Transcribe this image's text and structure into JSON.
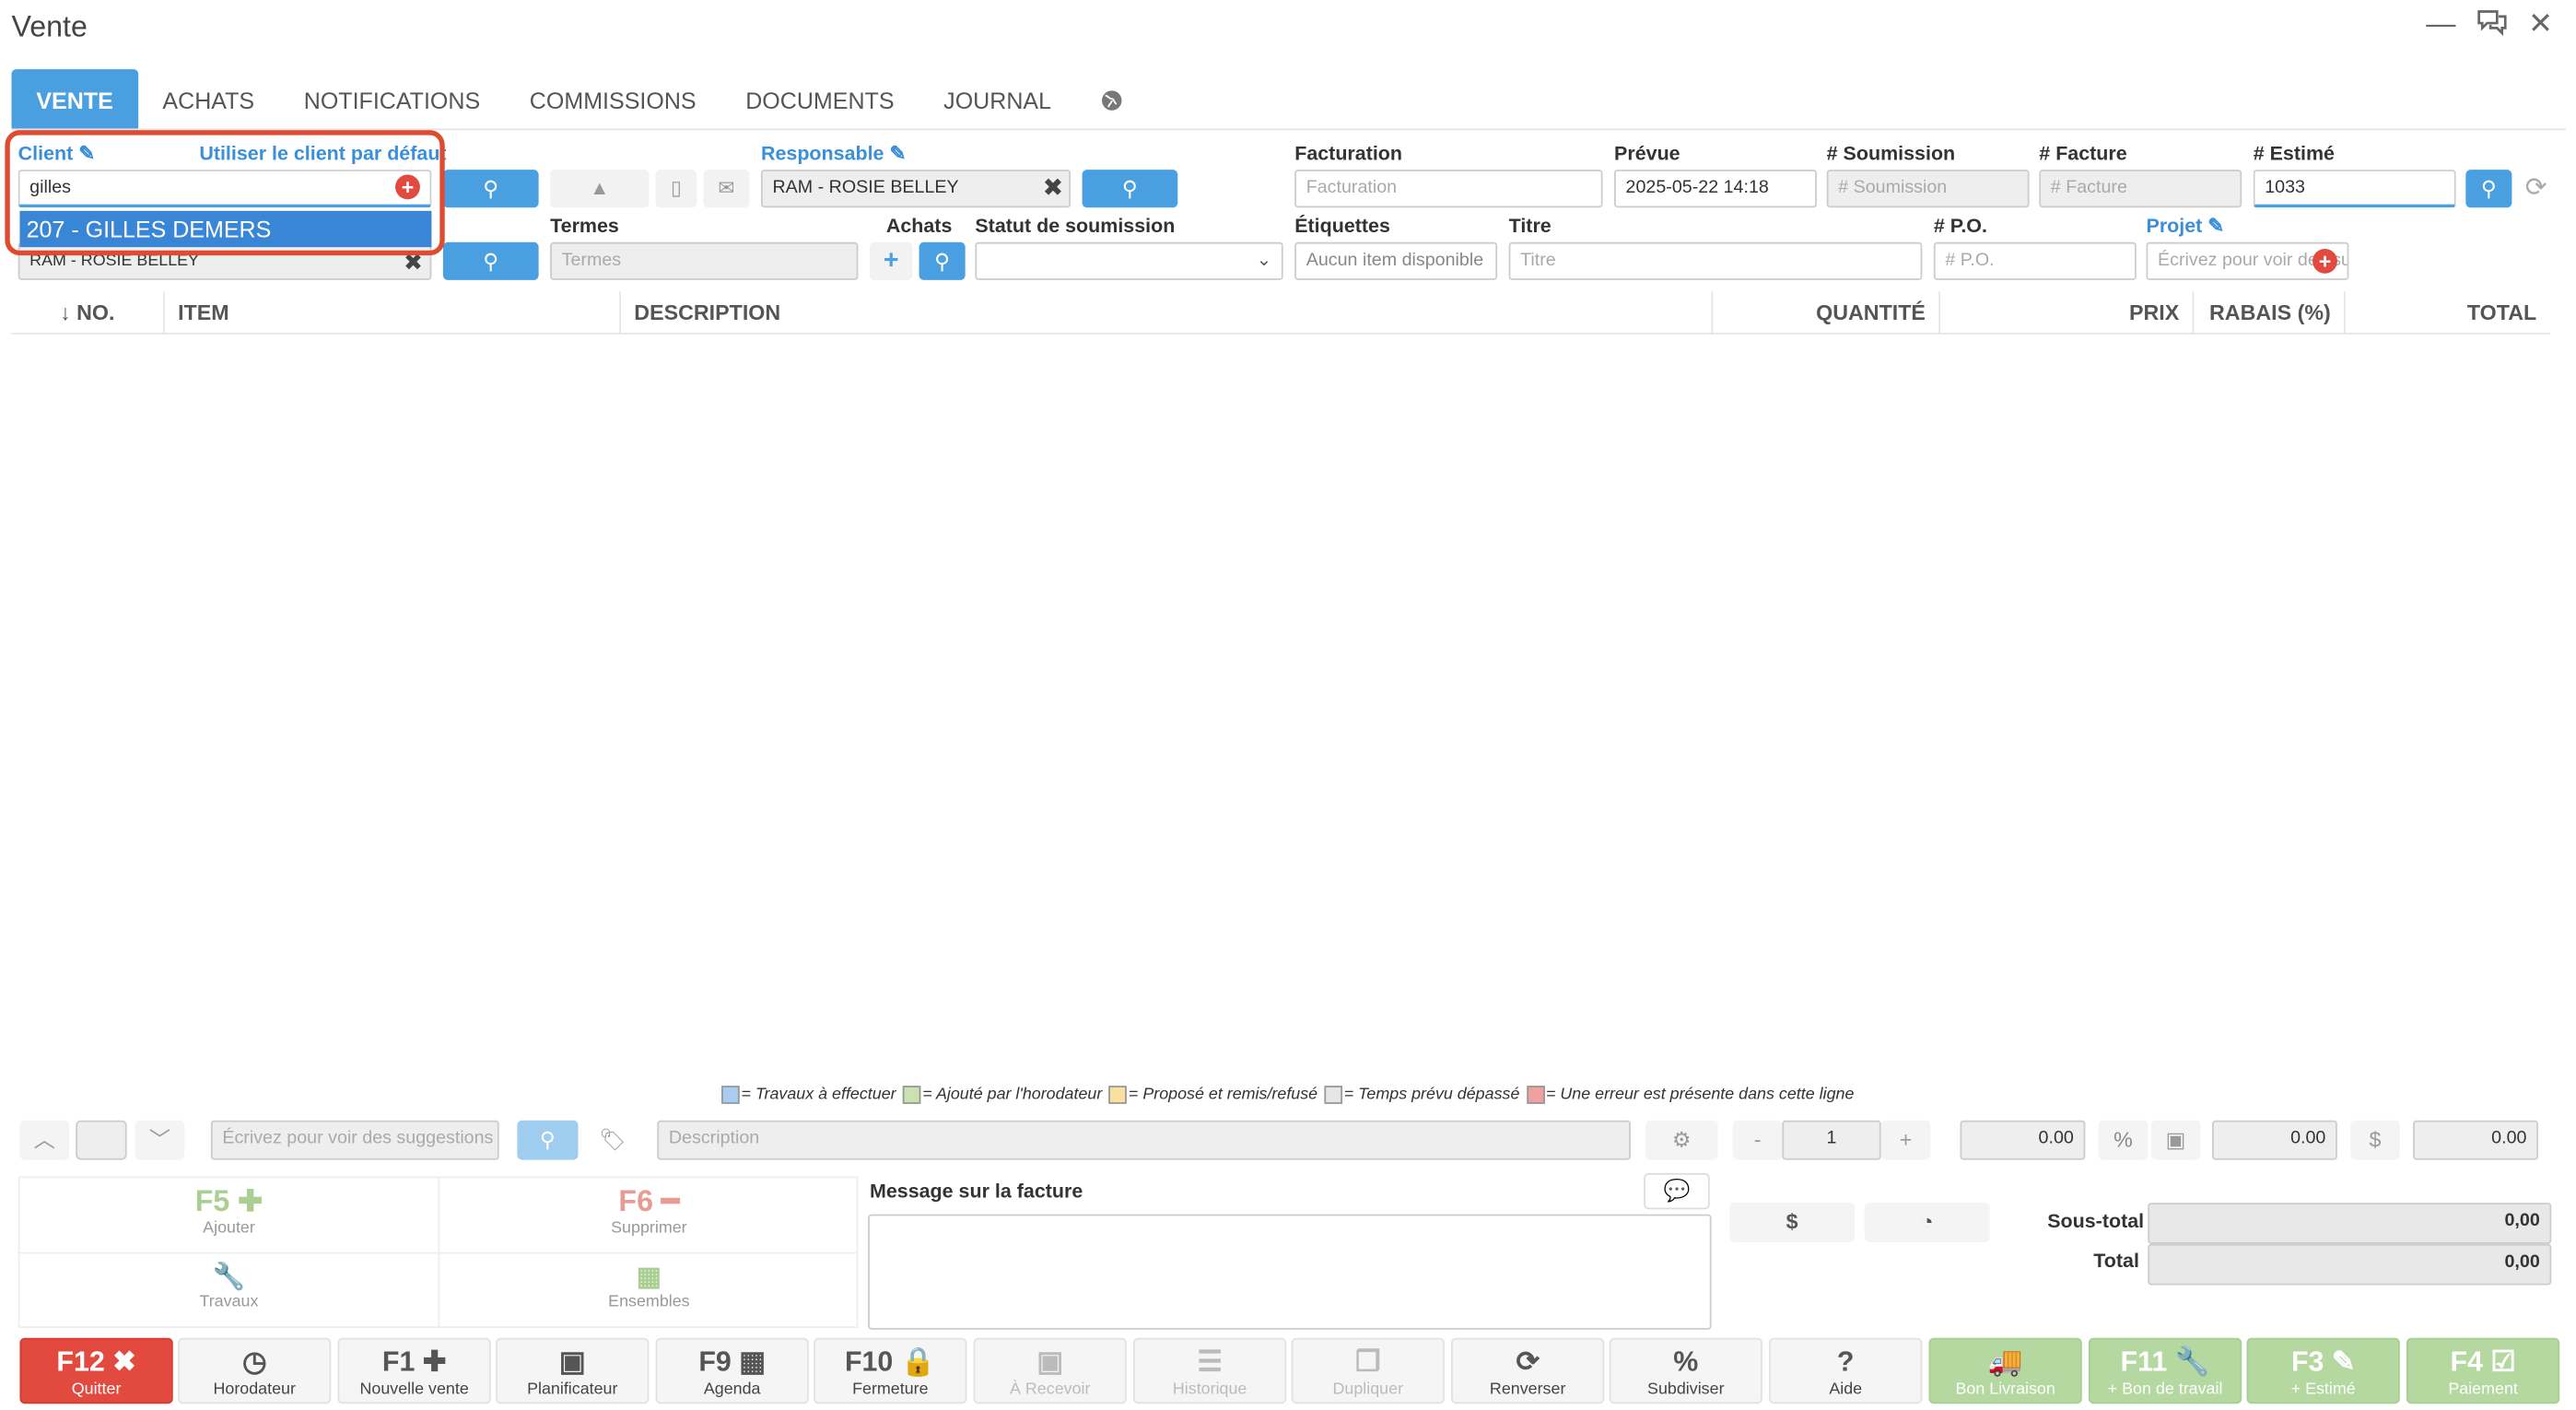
{
  "window": {
    "title": "Vente"
  },
  "tabs": [
    "VENTE",
    "ACHATS",
    "NOTIFICATIONS",
    "COMMISSIONS",
    "DOCUMENTS",
    "JOURNAL"
  ],
  "client": {
    "label": "Client",
    "default_link": "Utiliser le client par défaut",
    "value": "gilles",
    "suggestion": "207 - GILLES DEMERS",
    "second_value": "RAM - ROSIE BELLEY"
  },
  "responsable": {
    "label": "Responsable",
    "value": "RAM - ROSIE BELLEY"
  },
  "fields": {
    "facturation": {
      "label": "Facturation",
      "placeholder": "Facturation"
    },
    "prevue": {
      "label": "Prévue",
      "value": "2025-05-22 14:18"
    },
    "soumission": {
      "label": "# Soumission",
      "placeholder": "# Soumission"
    },
    "facture": {
      "label": "# Facture",
      "placeholder": "# Facture"
    },
    "estime": {
      "label": "# Estimé",
      "value": "1033"
    },
    "termes": {
      "label": "Termes",
      "placeholder": "Termes"
    },
    "achats": {
      "label": "Achats"
    },
    "statut": {
      "label": "Statut de soumission",
      "value": ""
    },
    "etiquettes": {
      "label": "Étiquettes",
      "value": "Aucun item disponible"
    },
    "titre": {
      "label": "Titre",
      "placeholder": "Titre"
    },
    "po": {
      "label": "# P.O.",
      "placeholder": "# P.O."
    },
    "projet": {
      "label": "Projet",
      "placeholder": "Écrivez pour voir des suggestions"
    }
  },
  "table": {
    "columns": [
      "↓ NO.",
      "ITEM",
      "DESCRIPTION",
      "QUANTITÉ",
      "PRIX",
      "RABAIS (%)",
      "TOTAL"
    ]
  },
  "legend": [
    {
      "color": "#a9cdf0",
      "text": "= Travaux à effectuer"
    },
    {
      "color": "#c9e2b0",
      "text": "= Ajouté par l'horodateur"
    },
    {
      "color": "#f7e0a0",
      "text": "= Proposé et remis/refusé"
    },
    {
      "color": "#e6e6e6",
      "text": "= Temps prévu dépassé"
    },
    {
      "color": "#f0a0a0",
      "text": "= Une erreur est présente dans cette ligne"
    }
  ],
  "item_entry": {
    "suggest_placeholder": "Écrivez pour voir des suggestions",
    "description_placeholder": "Description",
    "qty": "1",
    "price": "0.00",
    "discount": "0.00",
    "amount": "0.00"
  },
  "actions": {
    "f5": {
      "key": "F5",
      "label": "Ajouter"
    },
    "f6": {
      "key": "F6",
      "label": "Supprimer"
    },
    "travaux": {
      "label": "Travaux"
    },
    "ensembles": {
      "label": "Ensembles"
    }
  },
  "message": {
    "label": "Message sur la facture"
  },
  "totals": {
    "subtotal_label": "Sous-total",
    "subtotal": "0,00",
    "total_label": "Total",
    "total": "0,00"
  },
  "bottom_buttons": [
    {
      "key": "F12",
      "label": "Quitter"
    },
    {
      "key": "",
      "label": "Horodateur"
    },
    {
      "key": "F1",
      "label": "Nouvelle vente"
    },
    {
      "key": "",
      "label": "Planificateur"
    },
    {
      "key": "F9",
      "label": "Agenda"
    },
    {
      "key": "F10",
      "label": "Fermeture"
    },
    {
      "key": "",
      "label": "À Recevoir"
    },
    {
      "key": "",
      "label": "Historique"
    },
    {
      "key": "",
      "label": "Dupliquer"
    },
    {
      "key": "",
      "label": "Renverser"
    },
    {
      "key": "",
      "label": "Subdiviser"
    },
    {
      "key": "",
      "label": "Aide"
    },
    {
      "key": "",
      "label": "Bon Livraison"
    },
    {
      "key": "F11",
      "label": "+ Bon de travail"
    },
    {
      "key": "F3",
      "label": "+ Estimé"
    },
    {
      "key": "F4",
      "label": "Paiement"
    }
  ]
}
